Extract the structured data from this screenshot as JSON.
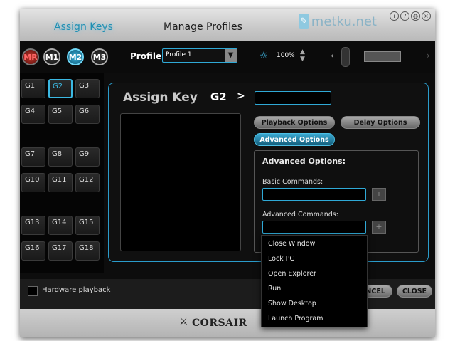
{
  "tabs": [
    "Assign Keys",
    "Manage Profiles"
  ],
  "watermark": "metku.net",
  "window_controls": [
    "i",
    "?",
    "◍",
    "×"
  ],
  "modes": [
    "MR",
    "M1",
    "M2",
    "M3"
  ],
  "profile": {
    "label": "Profile",
    "selected": "Profile 1"
  },
  "brightness": {
    "value": "100%"
  },
  "gkeys": [
    "G1",
    "G2",
    "G3",
    "G4",
    "G5",
    "G6",
    "G7",
    "G8",
    "G9",
    "G10",
    "G11",
    "G12",
    "G13",
    "G14",
    "G15",
    "G16",
    "G17",
    "G18"
  ],
  "selected_key": "G2",
  "assign": {
    "title": "Assign Key",
    "key": "G2",
    "arrow": ">",
    "buttons": [
      "Playback Options",
      "Delay Options",
      "Advanced Options"
    ],
    "active_button": "Advanced Options"
  },
  "advanced": {
    "title": "Advanced Options:",
    "basic_label": "Basic Commands:",
    "advanced_label": "Advanced Commands:"
  },
  "dropdown_options": [
    "Close Window",
    "Lock PC",
    "Open Explorer",
    "Run",
    "Show Desktop",
    "Launch Program"
  ],
  "bottom": {
    "hardware_playback": "Hardware playback",
    "cancel": "CANCEL",
    "close": "CLOSE"
  },
  "brand": "CORSAIR",
  "colors": {
    "accent": "#3bb8e2",
    "panel_border": "#2a9ccb",
    "mr_red": "#c0392b"
  }
}
